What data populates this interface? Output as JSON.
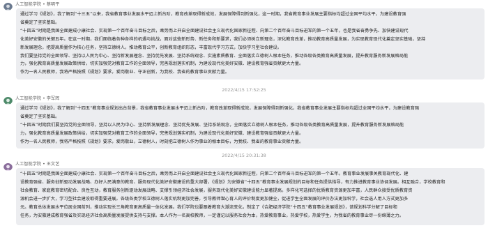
{
  "posts": [
    {
      "author": "人工智能学院 • 蔡明平",
      "lines": [
        "通过学习《规划》，我了解到“十三五”以来，我省教育事业发展水平迈上新台阶，教育改革取得新成效，发展保障得到新强化，这一时期，我省教育事业发展主要指标均超过全国平均水平，为建设教育强",
        "省奠定了坚实基础。",
        "“十四五”时期是我国全面建成小康社会、实现第一个百年奋斗目标之后，乘势而上开启全面建设社会主义现代化国家新征程、向第二个百年奋斗目标进军的第一个五年，也是我省奋勇争先、加快建设现代",
        "化美好安徽的关键五年。在这一时期，我们面临着各种各样的机遇与挑战，面对这些新形势、新任务和新要求，我们必须树立新理念，深化教育改革，推动教育高质量发展，为实现教育现代化奠定坚实基础，坚持",
        "新发展理念，把提高质量作为核心任务，坚持立德树人，推动教育公平，创新教育组织形态，丰富现代学习方式，加快学习型社会建设。",
        "我们要坚持党的全面领导、坚持以人民为中心、坚持新发展理念、坚持优先发展、坚持系统观念、实施素质教育、全面落实立德树人根本任务，推动各级各类教育高质量发展，提升教育服务新发展格局能",
        "力，强化教育高质量发展政策供给，切实加强党对教育工作的全面领导，完善规划落实机制，为建设现代化美好安徽、建设教育强省贡献更大力量。",
        "作为一名人民教师，我将严格按照《规划》要求，爱岗敬业、守正创新，为我校、我省的教育事业贡献力量。"
      ]
    },
    {
      "timestamp": "2022/4/15 17:52:25",
      "author": "人工智能学院 • 李军辉",
      "lines": [
        "通过学习《规划》，我了解到“十四五”教育事业规划出台背景，我省教育事业发展水平迈上新台阶，教育改革取得新成效，发展保障得到新强化，我省教育事业发展主要指标均超过全国平均水平，为建设教育强",
        "省奠定了坚实基础。",
        "“十四五”时期我们要坚持党的全面领导，坚持以人民为中心、坚持新发展理念、坚持优先发展、坚持系统观念，全面落实立德树人根本任务，推动各级各类教育高质量发展，提升教育服务新发展格局能",
        "力，强化教育高质量发展政策供给，切实加强党对教育工作的全面领导，完善规划落实机制，为建设现代化美好安徽、建设教育强省贡献更大力量。",
        "作为一名人民教师，我将严格按照《规划》要求，爱岗敬业，立德树人，时刻把立德树人作为事业的根本目标，为我校、我省的教育事业贡献力量。"
      ]
    },
    {
      "timestamp": "2022/4/15 20:31:38",
      "author": "人工智能学院 • 王文艺",
      "lines": [
        "“十四五”时期是我国全面建成小康社会、实现第一个百年奋斗目标之后，乘势而上开启全面建设社会主义现代化国家新征程，向第二个百年奋斗目标进军的第一个五年。教育事业发展事关教育现代化、建",
        "设教育强省、服务创新驱动发展战略、办好人民满意的教育、服务现代化美好安徽建设的重大部署，《规划》为安徽省“十四五”教育事业发展规划的目标和任务提供指导，有力推进教育事业协调发展。相互融合，学校教育和",
        "社会教育、家庭教育密切配合、良性互动，教育服务创新驱动发展战略、支撑引领经济社会发展，服务现代化美好安徽建设能力显著提高。多样化可选择的优质教育资源更加丰富，人民群众接受优质教育资",
        "源机会进一步扩大，学习型社会建设取得重要进展。各级各类学校立德树人落实机制更加完善，引导教师潜心育人的评价制度更加健全，促进学生全面发展的评价办法更加科学，社会选人用人方式更加多",
        "元。教育总体发展水平位居全国前列，推动实现长三角教育更高质量一体化发展。我们学院也要跟着教育大潮流变化，制定了《合肥经济学院“十四五”教育事业发展规划》，该规划科学分解了目标和",
        "任务，为安徽建成教育强省及实现经济社会高质量发展提供支持与支撑。本人作为一名高校教师，一定谨记以服务社会为本，热爱教育事业，热爱学校，热爱学生，为我省的教育事业尽一份绵薄之力。"
      ]
    }
  ]
}
